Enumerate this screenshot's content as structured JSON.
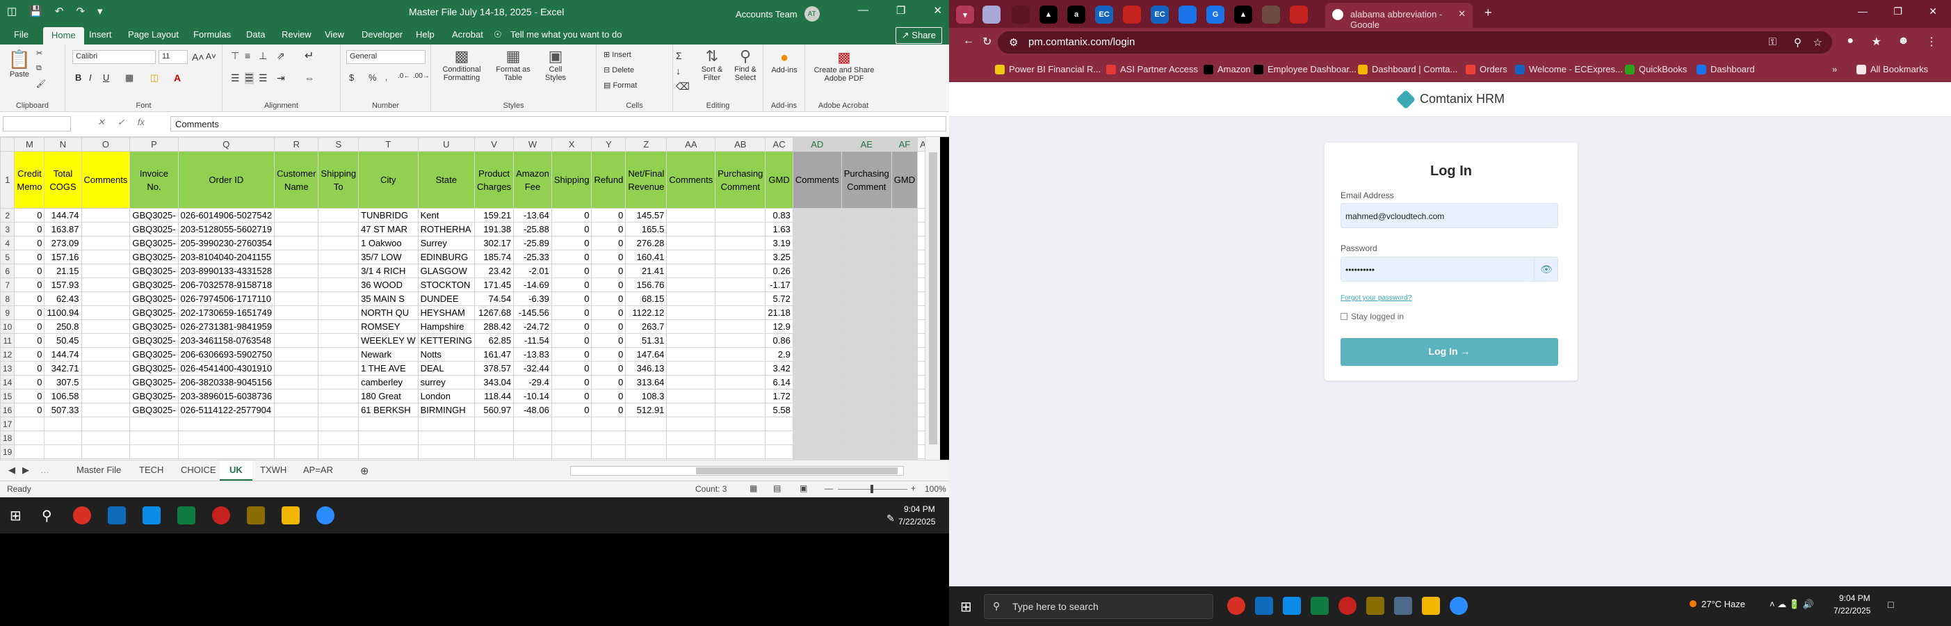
{
  "excel": {
    "title": "Master File July 14-18, 2025  -  Excel",
    "account": "Accounts Team",
    "avatar": "AT",
    "tabs": [
      "File",
      "Home",
      "Insert",
      "Page Layout",
      "Formulas",
      "Data",
      "Review",
      "View",
      "Developer",
      "Help",
      "Acrobat"
    ],
    "active_tab": "Home",
    "tell_me": "Tell me what you want to do",
    "share": "Share",
    "ribbon": {
      "clipboard": {
        "label": "Clipboard",
        "paste": "Paste"
      },
      "font": {
        "label": "Font",
        "name": "Calibri",
        "size": "11"
      },
      "alignment": {
        "label": "Alignment"
      },
      "number": {
        "label": "Number",
        "format": "General"
      },
      "styles": {
        "label": "Styles",
        "conditional": "Conditional Formatting",
        "format_table": "Format as Table",
        "cell_styles": "Cell Styles"
      },
      "cells": {
        "label": "Cells",
        "insert": "Insert",
        "delete": "Delete",
        "format": "Format"
      },
      "editing": {
        "label": "Editing",
        "sort": "Sort & Filter",
        "find": "Find & Select"
      },
      "addins": {
        "label": "Add-ins",
        "btn": "Add-ins"
      },
      "acrobat": {
        "label": "Adobe Acrobat",
        "btn": "Create and Share Adobe PDF"
      }
    },
    "name_box": "",
    "formula": "Comments",
    "columns": [
      "M",
      "N",
      "O",
      "P",
      "Q",
      "R",
      "S",
      "T",
      "U",
      "V",
      "W",
      "X",
      "Y",
      "Z",
      "AA",
      "AB",
      "AC",
      "AD",
      "AE",
      "AF",
      "AG"
    ],
    "headers": [
      "Credit Memo",
      "Total COGS",
      "Comments",
      "Invoice No.",
      "Order ID",
      "Customer Name",
      "Shipping To",
      "City",
      "State",
      "Product Charges",
      "Amazon Fee",
      "Shipping",
      "Refund",
      "Net/Final Revenue",
      "Comments",
      "Purchasing Comment",
      "GMD",
      "Comments",
      "Purchasing Comment",
      "GMD",
      ""
    ],
    "rows": [
      {
        "n": "2",
        "v": [
          "0",
          "144.74",
          "",
          "GBQ3025-",
          "026-6014906-5027542",
          "",
          "",
          "TUNBRIDG",
          "Kent",
          "159.21",
          "-13.64",
          "0",
          "0",
          "145.57",
          "",
          "",
          "0.83",
          "",
          "",
          "",
          ""
        ]
      },
      {
        "n": "3",
        "v": [
          "0",
          "163.87",
          "",
          "GBQ3025-",
          "203-5128055-5602719",
          "",
          "",
          "47 ST MAR",
          "ROTHERHA",
          "191.38",
          "-25.88",
          "0",
          "0",
          "165.5",
          "",
          "",
          "1.63",
          "",
          "",
          "",
          ""
        ]
      },
      {
        "n": "4",
        "v": [
          "0",
          "273.09",
          "",
          "GBQ3025-",
          "205-3990230-2760354",
          "",
          "",
          "1 Oakwoo",
          "Surrey",
          "302.17",
          "-25.89",
          "0",
          "0",
          "276.28",
          "",
          "",
          "3.19",
          "",
          "",
          "",
          ""
        ]
      },
      {
        "n": "5",
        "v": [
          "0",
          "157.16",
          "",
          "GBQ3025-",
          "203-8104040-2041155",
          "",
          "",
          "35/7 LOW",
          "EDINBURG",
          "185.74",
          "-25.33",
          "0",
          "0",
          "160.41",
          "",
          "",
          "3.25",
          "",
          "",
          "",
          ""
        ]
      },
      {
        "n": "6",
        "v": [
          "0",
          "21.15",
          "",
          "GBQ3025-",
          "203-8990133-4331528",
          "",
          "",
          "3/1 4 RICH",
          "GLASGOW",
          "23.42",
          "-2.01",
          "0",
          "0",
          "21.41",
          "",
          "",
          "0.26",
          "",
          "",
          "",
          ""
        ]
      },
      {
        "n": "7",
        "v": [
          "0",
          "157.93",
          "",
          "GBQ3025-",
          "206-7032578-9158718",
          "",
          "",
          "36 WOOD",
          "STOCKTON",
          "171.45",
          "-14.69",
          "0",
          "0",
          "156.76",
          "",
          "",
          "-1.17",
          "",
          "",
          "",
          ""
        ]
      },
      {
        "n": "8",
        "v": [
          "0",
          "62.43",
          "",
          "GBQ3025-",
          "026-7974506-1717110",
          "",
          "",
          "35 MAIN S",
          "DUNDEE",
          "74.54",
          "-6.39",
          "0",
          "0",
          "68.15",
          "",
          "",
          "5.72",
          "",
          "",
          "",
          ""
        ]
      },
      {
        "n": "9",
        "v": [
          "0",
          "1100.94",
          "",
          "GBQ3025-",
          "202-1730659-1651749",
          "",
          "",
          "NORTH QU",
          "HEYSHAM",
          "1267.68",
          "-145.56",
          "0",
          "0",
          "1122.12",
          "",
          "",
          "21.18",
          "",
          "",
          "",
          ""
        ]
      },
      {
        "n": "10",
        "v": [
          "0",
          "250.8",
          "",
          "GBQ3025-",
          "026-2731381-9841959",
          "",
          "",
          "ROMSEY",
          "Hampshire",
          "288.42",
          "-24.72",
          "0",
          "0",
          "263.7",
          "",
          "",
          "12.9",
          "",
          "",
          "",
          ""
        ]
      },
      {
        "n": "11",
        "v": [
          "0",
          "50.45",
          "",
          "GBQ3025-",
          "203-3461158-0763548",
          "",
          "",
          "WEEKLEY W",
          "KETTERING",
          "62.85",
          "-11.54",
          "0",
          "0",
          "51.31",
          "",
          "",
          "0.86",
          "",
          "",
          "",
          ""
        ]
      },
      {
        "n": "12",
        "v": [
          "0",
          "144.74",
          "",
          "GBQ3025-",
          "206-6306693-5902750",
          "",
          "",
          "Newark",
          "Notts",
          "161.47",
          "-13.83",
          "0",
          "0",
          "147.64",
          "",
          "",
          "2.9",
          "",
          "",
          "",
          ""
        ]
      },
      {
        "n": "13",
        "v": [
          "0",
          "342.71",
          "",
          "GBQ3025-",
          "026-4541400-4301910",
          "",
          "",
          "1 THE AVE",
          "DEAL",
          "378.57",
          "-32.44",
          "0",
          "0",
          "346.13",
          "",
          "",
          "3.42",
          "",
          "",
          "",
          ""
        ]
      },
      {
        "n": "14",
        "v": [
          "0",
          "307.5",
          "",
          "GBQ3025-",
          "206-3820338-9045156",
          "",
          "",
          "camberley",
          "surrey",
          "343.04",
          "-29.4",
          "0",
          "0",
          "313.64",
          "",
          "",
          "6.14",
          "",
          "",
          "",
          ""
        ]
      },
      {
        "n": "15",
        "v": [
          "0",
          "106.58",
          "",
          "GBQ3025-",
          "203-3896015-6038736",
          "",
          "",
          "180 Great",
          "London",
          "118.44",
          "-10.14",
          "0",
          "0",
          "108.3",
          "",
          "",
          "1.72",
          "",
          "",
          "",
          ""
        ]
      },
      {
        "n": "16",
        "v": [
          "0",
          "507.33",
          "",
          "GBQ3025-",
          "026-5114122-2577904",
          "",
          "",
          "61 BERKSH",
          "BIRMINGH",
          "560.97",
          "-48.06",
          "0",
          "0",
          "512.91",
          "",
          "",
          "5.58",
          "",
          "",
          "",
          ""
        ]
      },
      {
        "n": "17",
        "v": [
          "",
          "",
          "",
          "",
          "",
          "",
          "",
          "",
          "",
          "",
          "",
          "",
          "",
          "",
          "",
          "",
          "",
          "",
          "",
          "",
          ""
        ]
      },
      {
        "n": "18",
        "v": [
          "",
          "",
          "",
          "",
          "",
          "",
          "",
          "",
          "",
          "",
          "",
          "",
          "",
          "",
          "",
          "",
          "",
          "",
          "",
          "",
          ""
        ]
      },
      {
        "n": "19",
        "v": [
          "",
          "",
          "",
          "",
          "",
          "",
          "",
          "",
          "",
          "",
          "",
          "",
          "",
          "",
          "",
          "",
          "",
          "",
          "",
          "",
          ""
        ]
      },
      {
        "n": "20",
        "v": [
          "",
          "",
          "",
          "",
          "",
          "",
          "",
          "",
          "",
          "",
          "",
          "",
          "",
          "",
          "",
          "",
          "",
          "",
          "",
          "",
          ""
        ]
      }
    ],
    "sheets": [
      "Master File",
      "TECH",
      "CHOICE",
      "UK",
      "TXWH",
      "AP=AR"
    ],
    "active_sheet": "UK",
    "status_ready": "Ready",
    "status_count": "Count: 3",
    "zoom": "100%",
    "taskbar_time": "9:04 PM",
    "taskbar_date": "7/22/2025"
  },
  "chrome": {
    "active_tab_title": "alabama abbreviation - Google",
    "url": "pm.comtanix.com/login",
    "bookmarks": [
      "Power BI Financial R...",
      "ASI Partner Access",
      "Amazon",
      "Employee Dashboar...",
      "Dashboard | Comta...",
      "Orders",
      "Welcome - ECExpres...",
      "QuickBooks",
      "Dashboard"
    ],
    "all_bookmarks": "All Bookmarks",
    "brand": "Comtanix HRM",
    "login_title": "Log In",
    "email_label": "Email Address",
    "email_value": "mahmed@vcloudtech.com",
    "password_label": "Password",
    "password_value": "••••••••••",
    "forgot": "Forgot your password?",
    "stay": "Stay logged in",
    "login_button": "Log In →",
    "search_placeholder": "Type here to search",
    "weather": "27°C  Haze",
    "time": "9:04 PM",
    "date": "7/22/2025"
  }
}
